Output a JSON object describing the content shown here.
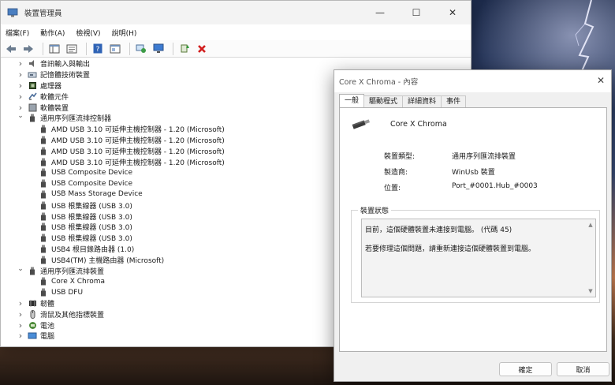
{
  "device_manager": {
    "title": "裝置管理員",
    "menu": [
      "檔案(F)",
      "動作(A)",
      "檢視(V)",
      "說明(H)"
    ],
    "tree": [
      {
        "level": 0,
        "expanded": false,
        "icon": "audio-icon",
        "label": "音訊輸入與輸出"
      },
      {
        "level": 0,
        "expanded": false,
        "icon": "storage-icon",
        "label": "記憶體技術裝置"
      },
      {
        "level": 0,
        "expanded": false,
        "icon": "processor-icon",
        "label": "處理器"
      },
      {
        "level": 0,
        "expanded": false,
        "icon": "software-component-icon",
        "label": "軟體元件"
      },
      {
        "level": 0,
        "expanded": false,
        "icon": "software-device-icon",
        "label": "軟體裝置"
      },
      {
        "level": 0,
        "expanded": true,
        "icon": "usb-icon",
        "label": "通用序列匯流排控制器"
      },
      {
        "level": 1,
        "icon": "usb-icon",
        "label": "AMD USB 3.10 可延伸主機控制器 - 1.20 (Microsoft)"
      },
      {
        "level": 1,
        "icon": "usb-icon",
        "label": "AMD USB 3.10 可延伸主機控制器 - 1.20 (Microsoft)"
      },
      {
        "level": 1,
        "icon": "usb-icon",
        "label": "AMD USB 3.10 可延伸主機控制器 - 1.20 (Microsoft)"
      },
      {
        "level": 1,
        "icon": "usb-icon",
        "label": "AMD USB 3.10 可延伸主機控制器 - 1.20 (Microsoft)"
      },
      {
        "level": 1,
        "icon": "usb-icon",
        "label": "USB Composite Device"
      },
      {
        "level": 1,
        "icon": "usb-icon",
        "label": "USB Composite Device"
      },
      {
        "level": 1,
        "icon": "usb-icon",
        "label": "USB Mass Storage Device"
      },
      {
        "level": 1,
        "icon": "usb-icon",
        "label": "USB 根集線器 (USB 3.0)"
      },
      {
        "level": 1,
        "icon": "usb-icon",
        "label": "USB 根集線器 (USB 3.0)"
      },
      {
        "level": 1,
        "icon": "usb-icon",
        "label": "USB 根集線器 (USB 3.0)"
      },
      {
        "level": 1,
        "icon": "usb-icon",
        "label": "USB 根集線器 (USB 3.0)"
      },
      {
        "level": 1,
        "icon": "usb-icon",
        "label": "USB4 根目錄路由器 (1.0)"
      },
      {
        "level": 1,
        "icon": "usb-icon",
        "label": "USB4(TM) 主機路由器 (Microsoft)"
      },
      {
        "level": 0,
        "expanded": true,
        "icon": "usb-icon",
        "label": "通用序列匯流排裝置"
      },
      {
        "level": 1,
        "icon": "usb-icon",
        "label": "Core X Chroma"
      },
      {
        "level": 1,
        "icon": "usb-icon",
        "label": "USB DFU"
      },
      {
        "level": 0,
        "expanded": false,
        "icon": "firmware-icon",
        "label": "韌體"
      },
      {
        "level": 0,
        "expanded": false,
        "icon": "mouse-icon",
        "label": "滑鼠及其他指標裝置"
      },
      {
        "level": 0,
        "expanded": false,
        "icon": "battery-icon",
        "label": "電池"
      },
      {
        "level": 0,
        "expanded": false,
        "icon": "computer-icon",
        "label": "電腦"
      }
    ]
  },
  "properties": {
    "title": "Core X Chroma - 內容",
    "tabs": [
      "一般",
      "驅動程式",
      "詳細資料",
      "事件"
    ],
    "device_name": "Core X Chroma",
    "type_label": "裝置類型:",
    "type_value": "通用序列匯流排裝置",
    "maker_label": "製造商:",
    "maker_value": "WinUsb 裝置",
    "location_label": "位置:",
    "location_value": "Port_#0001.Hub_#0003",
    "status_legend": "裝置狀態",
    "status_line1": "目前，這個硬體裝置未連接到電腦。 (代碼 45)",
    "status_line2": "若要修理這個問題，請重新連接這個硬體裝置到電腦。",
    "ok_label": "確定",
    "cancel_label": "取消"
  }
}
